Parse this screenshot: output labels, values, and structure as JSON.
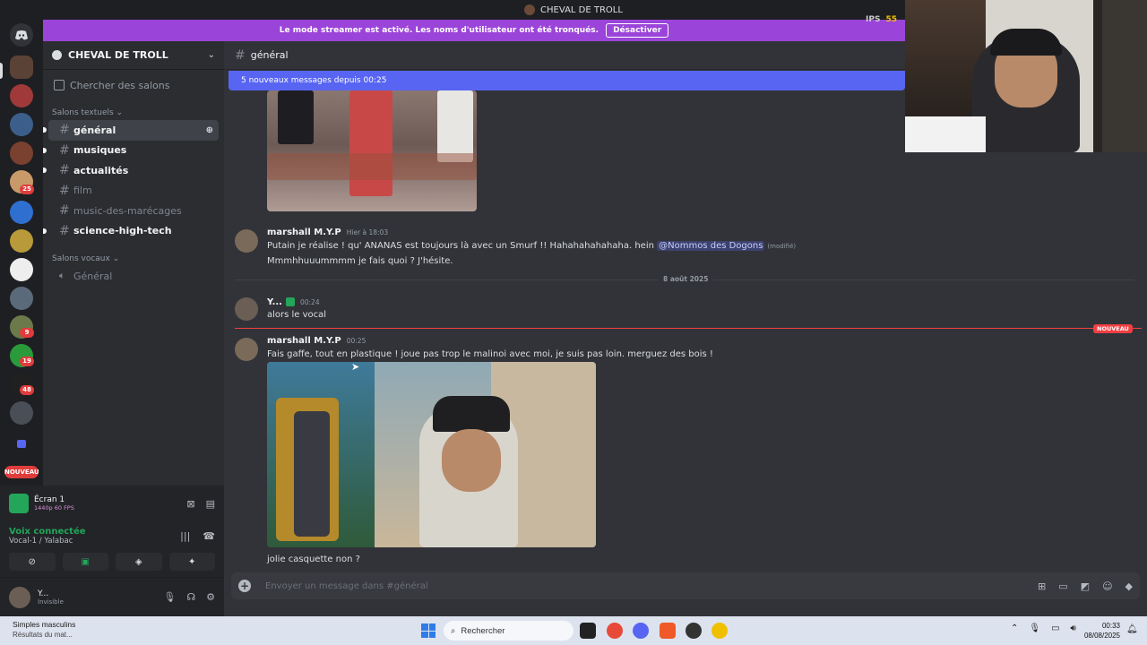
{
  "window": {
    "title": "CHEVAL DE TROLL"
  },
  "streamer_banner": {
    "text": "Le mode streamer est activé. Les noms d'utilisateur ont été tronqués.",
    "button": "Désactiver"
  },
  "fps": {
    "label": "IPS",
    "value": "55"
  },
  "guild_badges": [
    "25",
    "9",
    "19",
    "48"
  ],
  "guild_nouveau": "NOUVEAU",
  "server": {
    "name": "CHEVAL DE TROLL"
  },
  "sidebar": {
    "search_placeholder": "Chercher des salons",
    "text_category": "Salons textuels",
    "channels": [
      {
        "name": "général",
        "state": "active"
      },
      {
        "name": "musiques",
        "state": "unread"
      },
      {
        "name": "actualités",
        "state": "unread"
      },
      {
        "name": "film",
        "state": "muted"
      },
      {
        "name": "music-des-marécages",
        "state": "muted"
      },
      {
        "name": "science-high-tech",
        "state": "unread"
      }
    ],
    "voice_category": "Salons vocaux",
    "voice_channels": [
      "Général"
    ]
  },
  "voice_panel": {
    "screen_title": "Écran 1",
    "screen_sub": "1440p 60 FPS",
    "connected": "Voix connectée",
    "channel": "Vocal-1 / Yalabac",
    "user_name": "Y...",
    "user_status": "Invisible"
  },
  "chat": {
    "channel": "général",
    "new_messages_bar": "5 nouveaux messages depuis 00:25",
    "messages": [
      {
        "author": "marshall M.Y.P",
        "time": "Hier à 18:03",
        "line1_prefix": "Putain je réalise ! qu' ANANAS est toujours là avec un Smurf !! Hahahahahahaha. hein ",
        "mention": "@Nommos des Dogons",
        "edited": "(modifié)",
        "line2": "Mmmhhuuummmm je fais quoi ? J'hésite."
      },
      {
        "author": "Y...",
        "time": "00:24",
        "text": "alors le vocal"
      },
      {
        "author": "marshall M.Y.P",
        "time": "00:25",
        "text": "Fais gaffe, tout en plastique ! joue pas trop le malinoi avec moi, je suis pas loin. merguez des bois !",
        "after_image": "jolie casquette non ?"
      }
    ],
    "date_divider": "8 août 2025",
    "new_tag": "NOUVEAU",
    "composer_placeholder": "Envoyer un message dans #général"
  },
  "taskbar": {
    "weather_title": "Simples masculins",
    "weather_sub": "Résultats du mat...",
    "search": "Rechercher",
    "time": "00:33",
    "date": "08/08/2025"
  },
  "colors": {
    "accent": "#5865f2",
    "streamer": "#9b44d9",
    "online": "#23a55a",
    "danger": "#f23f43"
  }
}
